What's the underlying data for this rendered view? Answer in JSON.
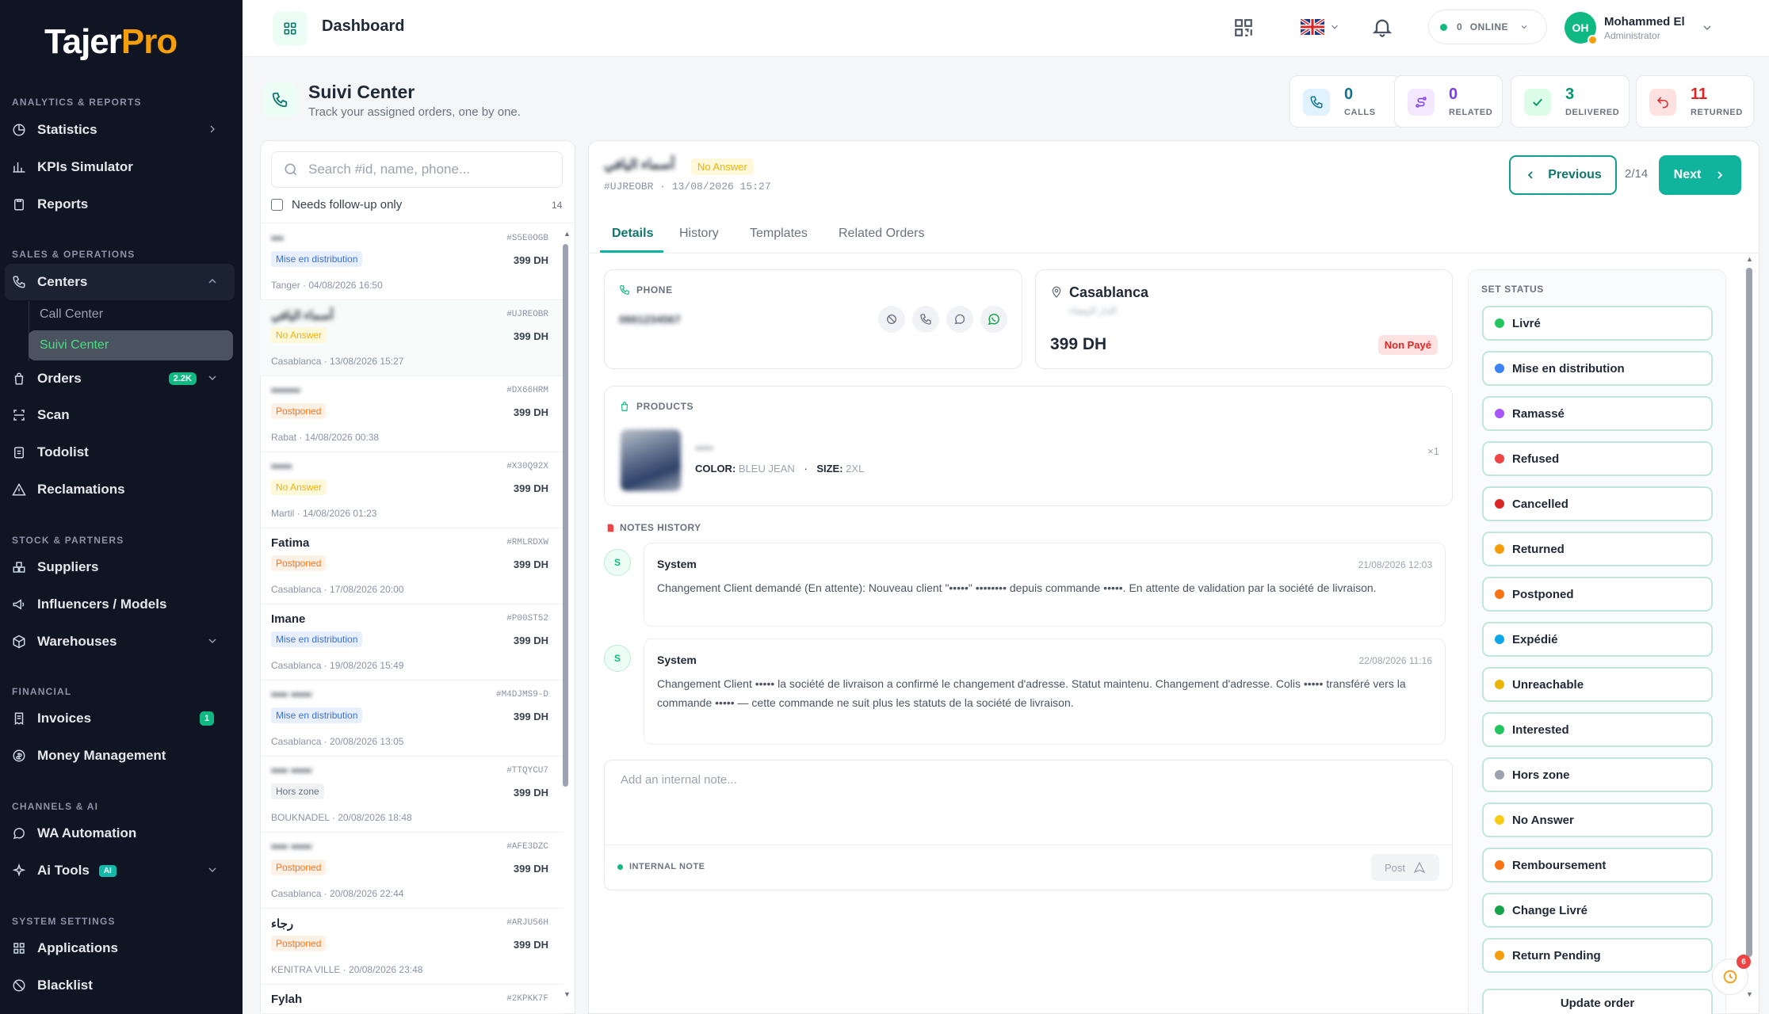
{
  "brand": {
    "name_a": "Tajer",
    "name_b": "Pro"
  },
  "sidebar": {
    "sections": {
      "analytics": "ANALYTICS & REPORTS",
      "sales": "SALES & OPERATIONS",
      "stock": "STOCK & PARTNERS",
      "financial": "FINANCIAL",
      "channels": "CHANNELS & AI",
      "system": "SYSTEM SETTINGS"
    },
    "items": {
      "statistics": "Statistics",
      "kpis": "KPIs Simulator",
      "reports": "Reports",
      "centers": "Centers",
      "call_center": "Call Center",
      "suivi_center": "Suivi Center",
      "orders": "Orders",
      "orders_badge": "2.2K",
      "scan": "Scan",
      "todolist": "Todolist",
      "reclamations": "Reclamations",
      "suppliers": "Suppliers",
      "influencers": "Influencers / Models",
      "warehouses": "Warehouses",
      "invoices": "Invoices",
      "invoices_badge": "1",
      "money": "Money Management",
      "wa": "WA Automation",
      "ai_tools": "Ai Tools",
      "ai_tag": "AI",
      "applications": "Applications",
      "blacklist": "Blacklist"
    }
  },
  "topbar": {
    "title": "Dashboard",
    "online_count": "0",
    "online_label": "ONLINE",
    "avatar_initials": "OH",
    "user_name": "Mohammed El",
    "user_role": "Administrator"
  },
  "page": {
    "title": "Suivi Center",
    "subtitle": "Track your assigned orders, one by one."
  },
  "stats": [
    {
      "value": "0",
      "label": "CALLS",
      "color": "#0e7490"
    },
    {
      "value": "0",
      "label": "RELATED",
      "color": "#7c3aed"
    },
    {
      "value": "3",
      "label": "DELIVERED",
      "color": "#059669"
    },
    {
      "value": "11",
      "label": "RETURNED",
      "color": "#dc2626"
    }
  ],
  "order_list": {
    "search_placeholder": "Search #id, name, phone...",
    "filter_label": "Needs follow-up only",
    "count": "14",
    "orders": [
      {
        "name": "•••",
        "id": "#S5E0OGB",
        "status": "Mise en distribution",
        "price": "399 DH",
        "loc": "Tanger · 04/08/2026 16:50"
      },
      {
        "name": "أسماء اليافي",
        "id": "#UJREOBR",
        "status": "No Answer",
        "price": "399 DH",
        "loc": "Casablanca · 13/08/2026 15:27"
      },
      {
        "name": "•••••••",
        "id": "#DX66HRM",
        "status": "Postponed",
        "price": "399 DH",
        "loc": "Rabat · 14/08/2026 00:38"
      },
      {
        "name": "•••••",
        "id": "#X30Q92X",
        "status": "No Answer",
        "price": "399 DH",
        "loc": "Martil · 14/08/2026 01:23"
      },
      {
        "name": "Fatima",
        "id": "#RMLRDXW",
        "status": "Postponed",
        "price": "399 DH",
        "loc": "Casablanca · 17/08/2026 20:00"
      },
      {
        "name": "Imane",
        "id": "#P00ST52",
        "status": "Mise en distribution",
        "price": "399 DH",
        "loc": "Casablanca · 19/08/2026 15:49"
      },
      {
        "name": "•••• •••••",
        "id": "#M4DJMS9-D",
        "status": "Mise en distribution",
        "price": "399 DH",
        "loc": "Casablanca · 20/08/2026 13:05"
      },
      {
        "name": "•••• •••••",
        "id": "#TTQYCU7",
        "status": "Hors zone",
        "price": "399 DH",
        "loc": "BOUKNADEL · 20/08/2026 18:48"
      },
      {
        "name": "•••• •••••",
        "id": "#AFE3DZC",
        "status": "Postponed",
        "price": "399 DH",
        "loc": "Casablanca · 20/08/2026 22:44"
      },
      {
        "name": "رجاء",
        "id": "#ARJU56H",
        "status": "Postponed",
        "price": "399 DH",
        "loc": "KENITRA VILLE · 20/08/2026 23:48"
      },
      {
        "name": "Fylah",
        "id": "#2KPKK7F",
        "status": "",
        "price": "",
        "loc": ""
      }
    ]
  },
  "detail": {
    "customer_name": "أسماء اليافي",
    "status": "No Answer",
    "ref": "#UJREOBR · 13/08/2026 15:27",
    "prev_label": "Previous",
    "pager": "2/14",
    "next_label": "Next",
    "tabs": [
      "Details",
      "History",
      "Templates",
      "Related Orders"
    ],
    "phone_label": "PHONE",
    "phone_value": "0661234567",
    "city": "Casablanca",
    "city_ar": "الدار البيضاء",
    "amount": "399 DH",
    "payment": "Non Payé",
    "products_label": "PRODUCTS",
    "product_name": "•••••",
    "color_label": "COLOR:",
    "color_value": "BLEU JEAN",
    "size_label": "SIZE:",
    "size_value": "2XL",
    "qty": "×1",
    "notes_label": "NOTES HISTORY",
    "notes": [
      {
        "avatar": "S",
        "author": "System",
        "date": "21/08/2026 12:03",
        "text": "Changement Client demandé (En attente): Nouveau client \"•••••\" •••••••• depuis commande •••••. En attente de validation par la société de livraison."
      },
      {
        "avatar": "S",
        "author": "System",
        "date": "22/08/2026 11:16",
        "text": "Changement Client ••••• la société de livraison a confirmé le changement d'adresse. Statut maintenu. Changement d'adresse. Colis ••••• transféré vers la commande ••••• — cette commande ne suit plus les statuts de la société de livraison."
      }
    ],
    "note_placeholder": "Add an internal note...",
    "internal_note_label": "INTERNAL NOTE",
    "post_label": "Post"
  },
  "status_panel": {
    "title": "SET STATUS",
    "options": [
      {
        "label": "Livré",
        "color": "#22c55e"
      },
      {
        "label": "Mise en distribution",
        "color": "#3b82f6"
      },
      {
        "label": "Ramassé",
        "color": "#a855f7"
      },
      {
        "label": "Refused",
        "color": "#ef4444"
      },
      {
        "label": "Cancelled",
        "color": "#dc2626"
      },
      {
        "label": "Returned",
        "color": "#f59e0b"
      },
      {
        "label": "Postponed",
        "color": "#f97316"
      },
      {
        "label": "Expédié",
        "color": "#0ea5e9"
      },
      {
        "label": "Unreachable",
        "color": "#eab308"
      },
      {
        "label": "Interested",
        "color": "#22c55e"
      },
      {
        "label": "Hors zone",
        "color": "#9ca3af"
      },
      {
        "label": "No Answer",
        "color": "#facc15"
      },
      {
        "label": "Remboursement",
        "color": "#f97316"
      },
      {
        "label": "Change Livré",
        "color": "#16a34a"
      },
      {
        "label": "Return Pending",
        "color": "#f59e0b"
      }
    ],
    "update_label": "Update order",
    "fab_count": "6"
  }
}
